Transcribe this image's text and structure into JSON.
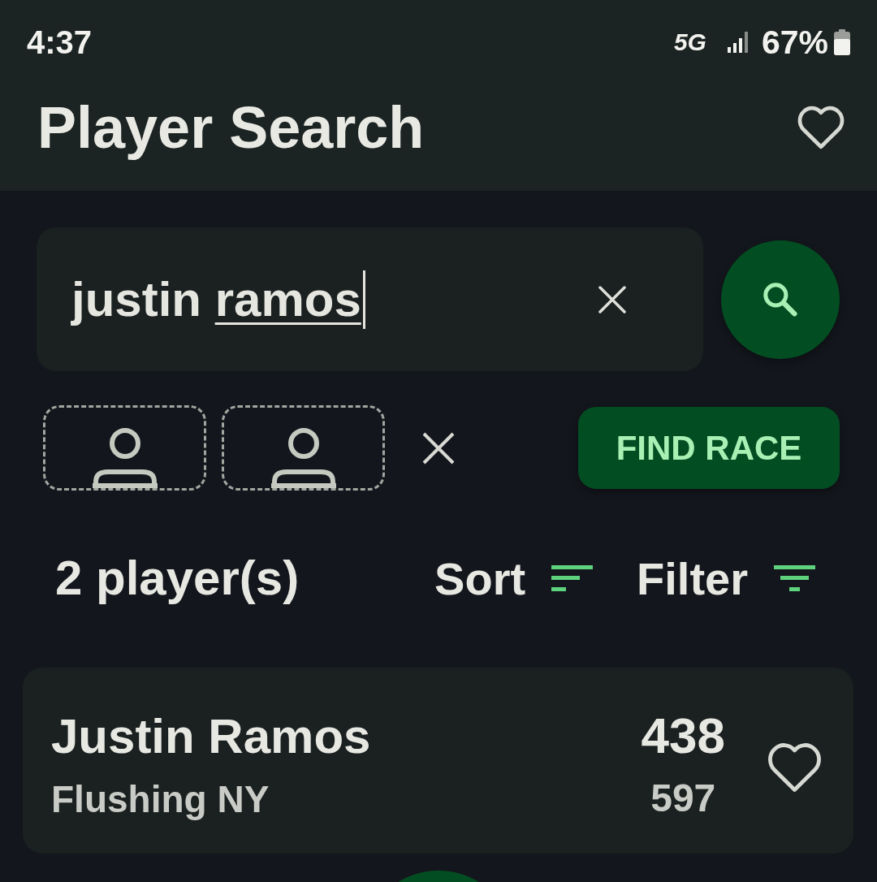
{
  "status_bar": {
    "time": "4:37",
    "network": "5G",
    "battery": "67%"
  },
  "app_bar": {
    "title": "Player Search"
  },
  "search": {
    "value": "justin ramos",
    "composing_last_word": true,
    "cursor": true
  },
  "player_slots": [
    {
      "kind": "empty"
    },
    {
      "kind": "empty"
    }
  ],
  "find_race_button": {
    "label": "FIND RACE"
  },
  "results": {
    "count": "2 player(s)",
    "sort": "Sort",
    "filter": "Filter"
  },
  "players": [
    {
      "name": "Justin Ramos",
      "location": "Flushing NY",
      "number_1": "438",
      "number_2": "597",
      "favorite": false
    }
  ]
}
